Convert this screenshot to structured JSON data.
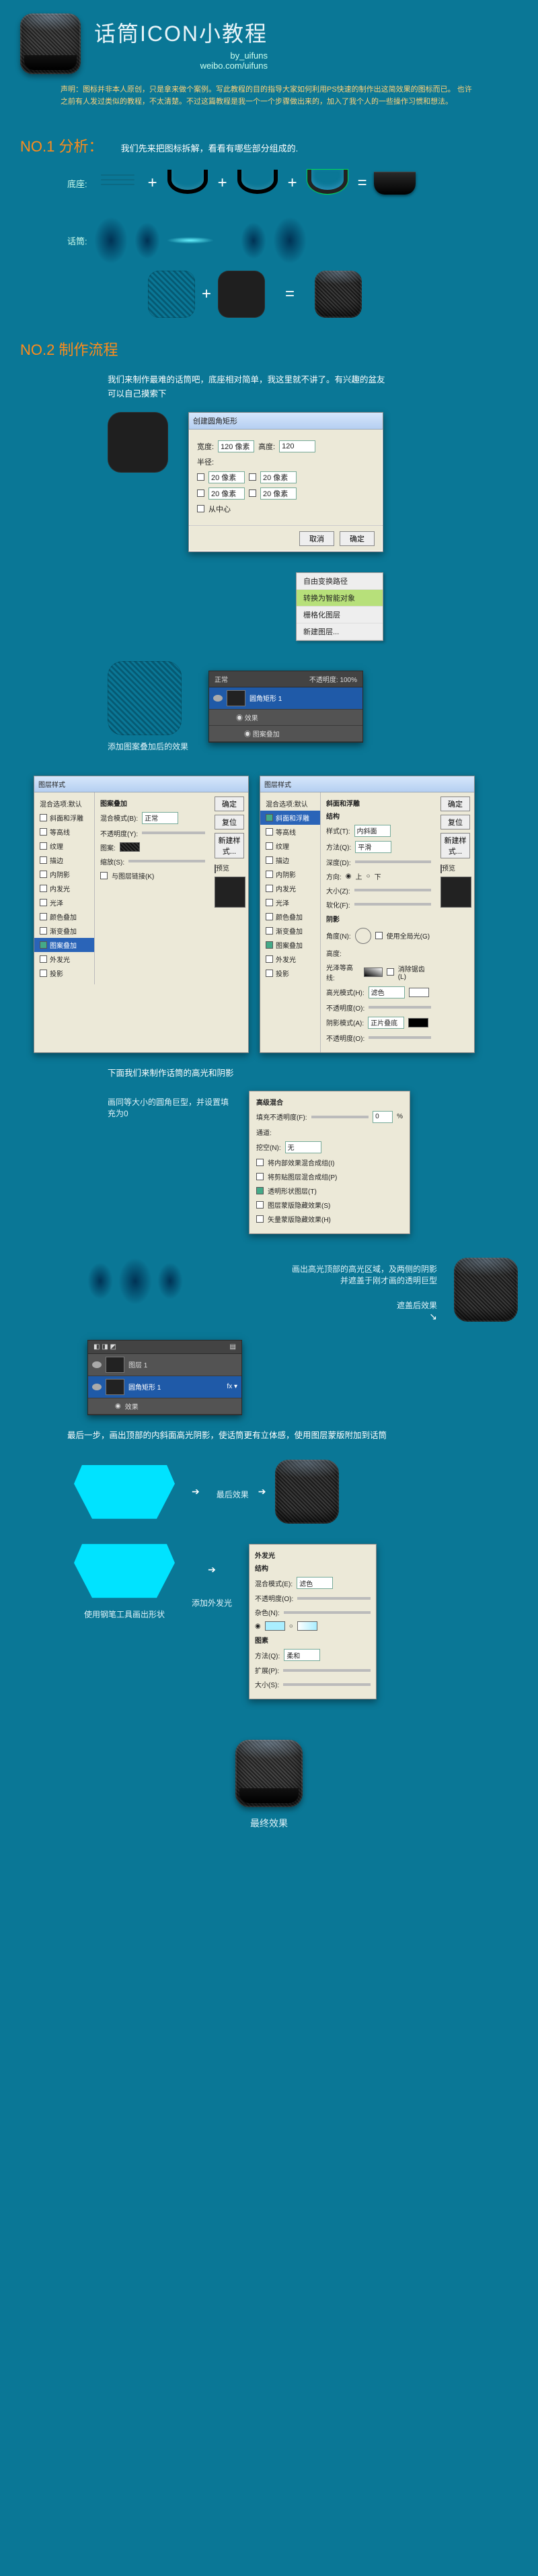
{
  "header": {
    "title": "话筒ICON小教程",
    "byline": "by_uifuns",
    "weibo": "weibo.com/uifuns"
  },
  "disclaimer": "声明：图标并非本人原创，只是拿来做个案例。写此教程的目的指导大家如何利用PS快速的制作出这简效果的图标而已。\n也许之前有人发过类似的教程，不太清楚。不过这篇教程是我一个一个步骤做出来的，加入了我个人的一些操作习惯和想法。",
  "sections": {
    "s1": {
      "h": "NO.1  分析：",
      "intro": "我们先来把图标拆解，看看有哪些部分组成的."
    },
    "s2": {
      "h": "NO.2 制作流程"
    }
  },
  "labels": {
    "base": "底座:",
    "mic": "话筒:",
    "afterPattern": "添加图案叠加后的效果",
    "lightShadow": "下面我们来制作话筒的高光和阴影",
    "drawSame": "画同等大小的圆角巨型，并设置填充为0",
    "drawHighlight": "画出高光顶部的高光区域，及两侧的阴影\n并遮盖于刚才画的透明巨型",
    "coverEffect": "遮盖后效果",
    "lastStep": "最后一步，画出顶部的内斜面高光阴影，使话筒更有立体感，使用图层蒙版附加到话筒",
    "finalEffect": "最后效果",
    "penShape": "使用钢笔工具画出形状",
    "addGlow": "添加外发光",
    "finalResult": "最终效果"
  },
  "process": {
    "intro": "我们来制作最难的话筒吧，底座相对简单，我这里就不讲了。有兴趣的盆友\n可以自己摸索下"
  },
  "dlg_rrect": {
    "title": "创建圆角矩形",
    "width_l": "宽度:",
    "width_v": "120 像素",
    "height_l": "高度:",
    "height_v": "120",
    "radii_l": "半径:",
    "r_tl": "20 像素",
    "r_tr": "20 像素",
    "r_bl": "20 像素",
    "r_br": "20 像素",
    "center": "从中心",
    "ok": "确定",
    "cancel": "取消"
  },
  "ctx": {
    "i1": "自由变换路径",
    "i2": "转换为智能对象",
    "i3": "栅格化图层",
    "i4": "新建图层..."
  },
  "layers": {
    "tab1": "正常",
    "opacity_l": "不透明度:",
    "opacity_v": "100%",
    "layer1": "圆角矩形 1",
    "fx": "效果",
    "fx1": "图案叠加"
  },
  "ls": {
    "title": "图层样式",
    "side": [
      "混合选项:默认",
      "斜面和浮雕",
      "等高线",
      "纹理",
      "描边",
      "内阴影",
      "内发光",
      "光泽",
      "颜色叠加",
      "渐变叠加",
      "图案叠加",
      "外发光",
      "投影"
    ],
    "btns": [
      "确定",
      "复位",
      "新建样式...",
      "预览"
    ],
    "bevel": {
      "title": "斜面和浮雕",
      "struct": "结构",
      "style_l": "样式(T):",
      "style_v": "内斜面",
      "method_l": "方法(Q):",
      "method_v": "平滑",
      "depth_l": "深度(D):",
      "dir_l": "方向:",
      "dir_up": "上",
      "dir_dn": "下",
      "size_l": "大小(Z):",
      "soft_l": "软化(F):",
      "shade": "阴影",
      "angle_l": "角度(N):",
      "global": "使用全局光(G)",
      "alt_l": "高度:",
      "gloss_l": "光泽等高线:",
      "anti": "消除锯齿(L)",
      "hmode_l": "高光模式(H):",
      "hmode_v": "滤色",
      "smode_l": "阴影模式(A):",
      "smode_v": "正片叠底",
      "op_l": "不透明度(O):"
    },
    "pattern": {
      "title": "图案叠加",
      "blend_l": "混合模式(B):",
      "blend_v": "正常",
      "op_l": "不透明度(Y):",
      "pat_l": "图案:",
      "scale_l": "缩放(S):",
      "link": "与图层链接(K)"
    },
    "glow": {
      "title": "外发光",
      "struct": "结构",
      "blend_l": "混合模式(E):",
      "blend_v": "滤色",
      "op_l": "不透明度(O):",
      "noise_l": "杂色(N):",
      "elem": "图素",
      "method_l": "方法(Q):",
      "method_v": "柔和",
      "spread_l": "扩展(P):",
      "size_l": "大小(S):"
    }
  },
  "fill": {
    "title": "高级混合",
    "op_l": "填充不透明度(F):",
    "op_v": "0",
    "pct": "%",
    "ch_l": "通道:",
    "knock_l": "挖空(N):",
    "knock_v": "无",
    "c1": "将内部效果混合成组(I)",
    "c2": "将剪贴图层混合成组(P)",
    "c3": "透明形状图层(T)",
    "c4": "图层蒙版隐藏效果(S)",
    "c5": "矢量蒙版隐藏效果(H)"
  },
  "layers2": {
    "l1": "图层 1",
    "l2": "圆角矩形 1",
    "fx": "效果"
  }
}
